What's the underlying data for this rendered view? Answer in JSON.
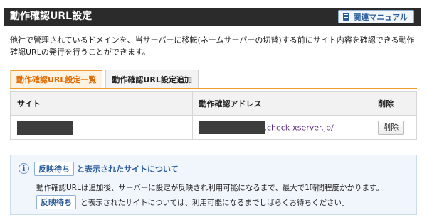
{
  "header": {
    "title": "動作確認URL設定",
    "manual_button": "関連マニュアル",
    "manual_icon": "book-icon"
  },
  "description": "他社で管理されているドメインを、当サーバーに移転(ネームサーバーの切替)する前にサイト内容を確認できる動作確認URLの発行を行うことができます。",
  "tabs": [
    {
      "label": "動作確認URL設定一覧",
      "active": true
    },
    {
      "label": "動作確認URL設定追加",
      "active": false
    }
  ],
  "table": {
    "columns": [
      "サイト",
      "動作確認アドレス",
      "削除"
    ],
    "rows": [
      {
        "address_suffix": ".check-xserver.jp/",
        "delete_label": "削除"
      }
    ]
  },
  "info": {
    "badge": "反映待ち",
    "title_suffix": "と表示されたサイトについて",
    "line1": "動作確認URLは追加後、サーバーに設定が反映され利用可能になるまで、最大で1時間程度かかります。",
    "line2": "と表示されたサイトについては、利用可能になるまでしばらくお待ちください。",
    "icon_glyph": "i"
  },
  "colors": {
    "accent_orange": "#f09a2b",
    "link_blue": "#2c5d9c",
    "header_bg": "#2b2b2b"
  }
}
